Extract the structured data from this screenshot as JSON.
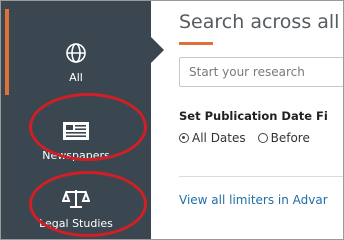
{
  "sidebar": {
    "items": [
      {
        "label": "All",
        "icon": "globe-icon",
        "active": true
      },
      {
        "label": "Newspapers",
        "icon": "newspaper-icon"
      },
      {
        "label": "Legal Studies",
        "icon": "scales-icon"
      }
    ]
  },
  "main": {
    "title": "Search across all",
    "search_placeholder": "Start your research",
    "pub_date_heading": "Set Publication Date Fi",
    "date_options": [
      {
        "label": "All Dates",
        "selected": true
      },
      {
        "label": "Before",
        "selected": false
      }
    ],
    "advanced_link": "View all limiters in Advar"
  },
  "colors": {
    "sidebar_bg": "#3a4650",
    "accent": "#e0703a",
    "highlight_circle": "#d11f26",
    "link": "#1f6fa8"
  }
}
